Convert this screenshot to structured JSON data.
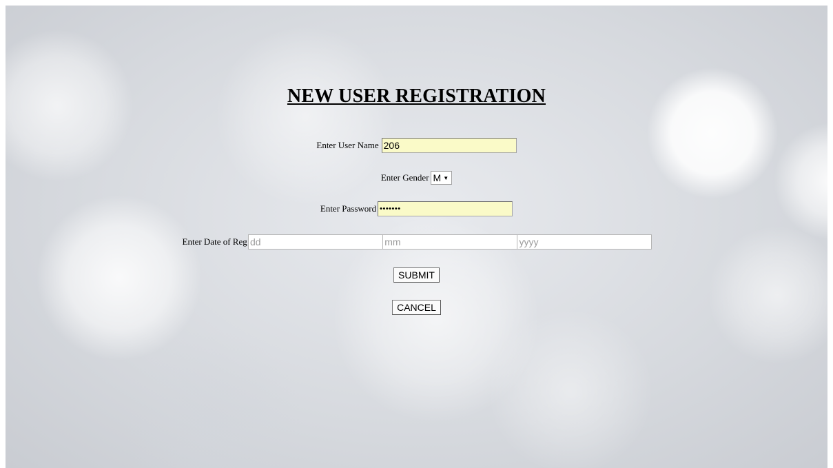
{
  "form": {
    "title": "NEW USER REGISTRATION",
    "username": {
      "label": "Enter User Name",
      "value": "206"
    },
    "gender": {
      "label": "Enter Gender",
      "selected": "M"
    },
    "password": {
      "label": "Enter Password",
      "masked_value": "•••••••"
    },
    "date_of_reg": {
      "label": "Enter Date of Reg",
      "day_placeholder": "dd",
      "month_placeholder": "mm",
      "year_placeholder": "yyyy"
    },
    "submit_label": "SUBMIT",
    "cancel_label": "CANCEL"
  },
  "colors": {
    "input_fill": "#fafac8",
    "background": "#d6d9de"
  }
}
